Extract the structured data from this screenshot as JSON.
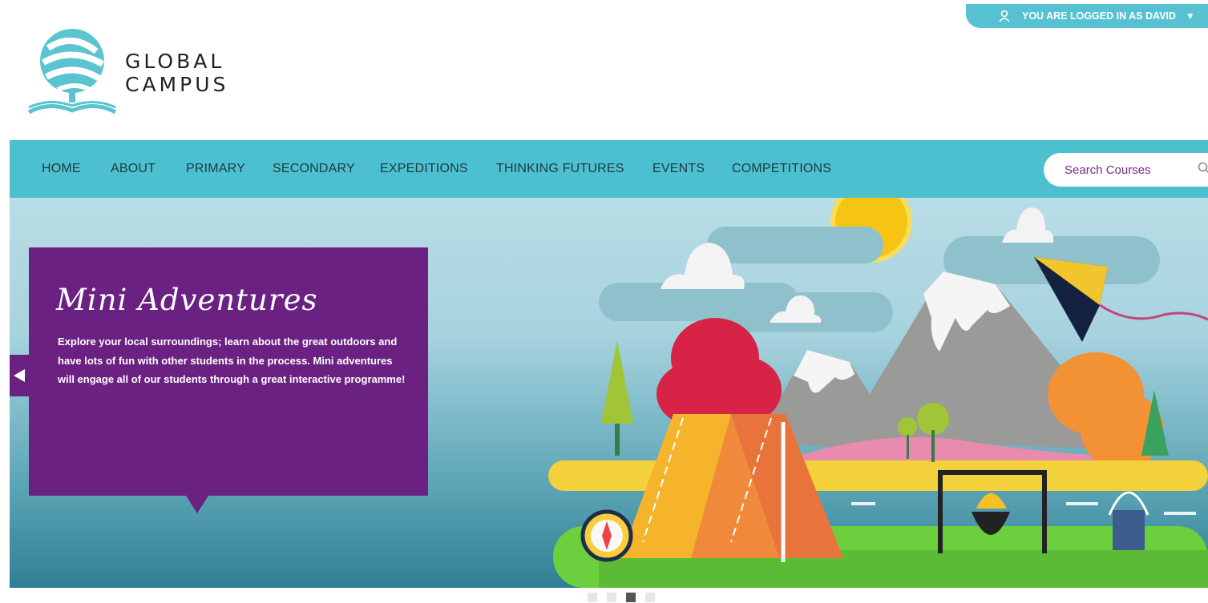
{
  "brand": {
    "line1": "GLOBAL",
    "line2": "CAMPUS"
  },
  "user_bar": {
    "text": "YOU ARE LOGGED IN AS DAVID",
    "icon": "user-icon",
    "caret": "▼"
  },
  "nav": {
    "items": [
      {
        "label": "HOME"
      },
      {
        "label": "ABOUT"
      },
      {
        "label": "PRIMARY"
      },
      {
        "label": "SECONDARY"
      },
      {
        "label": "EXPEDITIONS"
      },
      {
        "label": "THINKING FUTURES"
      },
      {
        "label": "EVENTS"
      },
      {
        "label": "COMPETITIONS"
      }
    ],
    "search_placeholder": "Search Courses"
  },
  "hero": {
    "title": "Mini Adventures",
    "description": "Explore your local surroundings; learn about the great outdoors and have lots of fun with other students in the process. Mini adventures will engage all of our students through a great interactive programme!"
  },
  "carousel": {
    "slide_count": 4,
    "active_index": 2
  },
  "colors": {
    "accent": "#4dc0cf",
    "promo": "#6b2182",
    "search_text": "#7b2a8a"
  }
}
